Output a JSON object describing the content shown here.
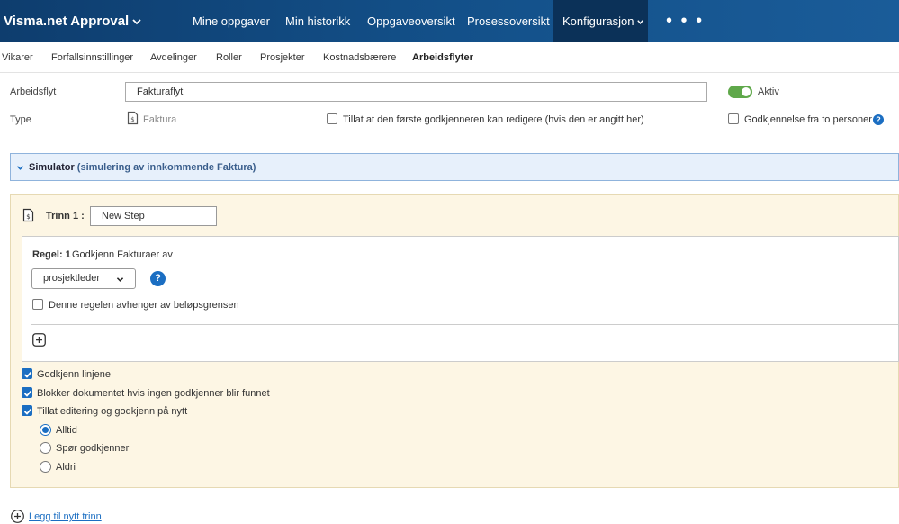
{
  "app": {
    "title": "Visma.net Approval"
  },
  "nav": {
    "items": [
      "Mine oppgaver",
      "Min historikk",
      "Oppgaveoversikt",
      "Prosessoversikt",
      "Konfigurasjon"
    ],
    "more": "• • •"
  },
  "subnav": {
    "items": [
      "Vikarer",
      "Forfallsinnstillinger",
      "Avdelinger",
      "Roller",
      "Prosjekter",
      "Kostnadsbærere",
      "Arbeidsflyter"
    ],
    "active": "Arbeidsflyter"
  },
  "form": {
    "workflow_label": "Arbeidsflyt",
    "workflow_value": "Fakturaflyt",
    "active_label": "Aktiv",
    "type_label": "Type",
    "type_value": "Faktura",
    "first_approver_edit": "Tillat at den første godkjenneren kan redigere (hvis den er angitt her)",
    "two_person": "Godkjennelse fra to personer"
  },
  "simulator": {
    "title": "Simulator",
    "subtitle": "(simulering av innkommende Faktura)"
  },
  "step": {
    "label": "Trinn 1 :",
    "name_value": "New Step",
    "rule_label": "Regel: 1",
    "rule_text": "Godkjenn Fakturaer av",
    "approver_select": "prosjektleder",
    "amount_limit": "Denne regelen avhenger av beløpsgrensen",
    "options": {
      "approve_lines": "Godkjenn linjene",
      "block_doc": "Blokker dokumentet hvis ingen godkjenner blir funnet",
      "allow_edit": "Tillat editering og godkjenn på nytt"
    },
    "radios": [
      "Alltid",
      "Spør godkjenner",
      "Aldri"
    ],
    "radio_selected": "Alltid"
  },
  "add_step": "Legg til nytt trinn",
  "colors": {
    "nav": "#135089",
    "accent": "#1b6ec2",
    "toggle_on": "#5fa84a",
    "step_bg": "#fdf6e4",
    "sim_bg": "#e7f0fb"
  }
}
